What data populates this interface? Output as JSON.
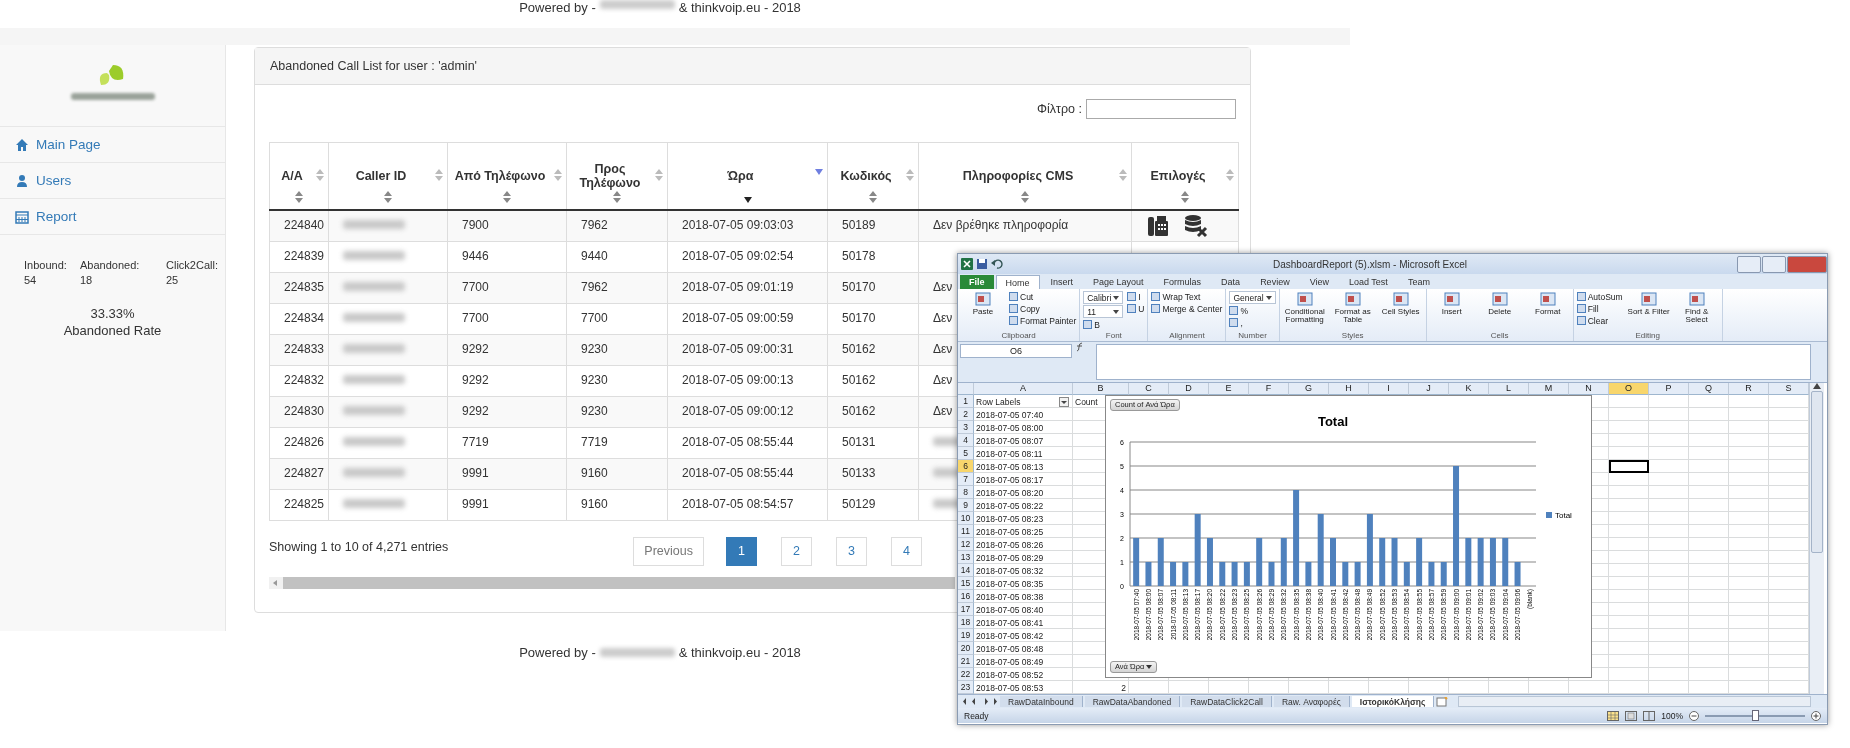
{
  "header": {
    "powered_prefix": "Powered by -",
    "powered_suffix": "& thinkvoip.eu - 2018"
  },
  "sidebar": {
    "items": [
      {
        "label": "Main Page"
      },
      {
        "label": "Users"
      },
      {
        "label": "Report"
      }
    ],
    "stats": [
      {
        "label": "Inbound:",
        "value": "54"
      },
      {
        "label": "Abandoned:",
        "value": "18"
      },
      {
        "label": "Click2Call:",
        "value": "25"
      }
    ],
    "rate": "33.33%",
    "rate_label": "Abandoned Rate"
  },
  "panel": {
    "title": "Abandoned Call List for user : 'admin'",
    "filter_label": "Φίλτρο :",
    "columns": [
      {
        "label": "A/A",
        "sorted": false
      },
      {
        "label": "Caller ID",
        "sorted": false
      },
      {
        "label": "Από Τηλέφωνο",
        "sorted": false
      },
      {
        "label": "Προς Τηλέφωνο",
        "sorted": false
      },
      {
        "label": "Ώρα",
        "sorted": true
      },
      {
        "label": "Κωδικός",
        "sorted": false
      },
      {
        "label": "Πληροφορίες CMS",
        "sorted": false
      },
      {
        "label": "Επιλογές",
        "sorted": false
      }
    ],
    "rows": [
      {
        "id": "224840",
        "from": "7900",
        "to": "7962",
        "time": "2018-07-05 09:03:03",
        "code": "50189",
        "cms": "Δεν βρέθηκε πληροφορία",
        "actions": true
      },
      {
        "id": "224839",
        "from": "9446",
        "to": "9440",
        "time": "2018-07-05 09:02:54",
        "code": "50178"
      },
      {
        "id": "224835",
        "from": "7700",
        "to": "7962",
        "time": "2018-07-05 09:01:19",
        "code": "50170",
        "cms": "Δεν"
      },
      {
        "id": "224834",
        "from": "7700",
        "to": "7700",
        "time": "2018-07-05 09:00:59",
        "code": "50170",
        "cms": "Δεν"
      },
      {
        "id": "224833",
        "from": "9292",
        "to": "9230",
        "time": "2018-07-05 09:00:31",
        "code": "50162",
        "cms": "Δεν"
      },
      {
        "id": "224832",
        "from": "9292",
        "to": "9230",
        "time": "2018-07-05 09:00:13",
        "code": "50162",
        "cms": "Δεν"
      },
      {
        "id": "224830",
        "from": "9292",
        "to": "9230",
        "time": "2018-07-05 09:00:12",
        "code": "50162",
        "cms": "Δεν"
      },
      {
        "id": "224826",
        "from": "7719",
        "to": "7719",
        "time": "2018-07-05 08:55:44",
        "code": "50131"
      },
      {
        "id": "224827",
        "from": "9991",
        "to": "9160",
        "time": "2018-07-05 08:55:44",
        "code": "50133"
      },
      {
        "id": "224825",
        "from": "9991",
        "to": "9160",
        "time": "2018-07-05 08:54:57",
        "code": "50129"
      }
    ],
    "info": "Showing 1 to 10 of 4,271 entries",
    "pagination": [
      {
        "label": "Previous",
        "kind": "nav",
        "selected": false
      },
      {
        "label": "1",
        "kind": "page",
        "selected": true
      },
      {
        "label": "2",
        "kind": "page",
        "selected": false
      },
      {
        "label": "3",
        "kind": "page",
        "selected": false
      },
      {
        "label": "4",
        "kind": "page",
        "selected": false
      }
    ]
  },
  "footer": {
    "powered_prefix": "Powered by -",
    "powered_suffix": "& thinkvoip.eu - 2018"
  },
  "excel": {
    "title": "DashboardReport (5).xlsm - Microsoft Excel",
    "tabs": [
      {
        "label": "File",
        "kind": "file",
        "selected": false
      },
      {
        "label": "Home",
        "kind": "tab",
        "selected": true
      },
      {
        "label": "Insert",
        "kind": "tab",
        "selected": false
      },
      {
        "label": "Page Layout",
        "kind": "tab",
        "selected": false
      },
      {
        "label": "Formulas",
        "kind": "tab",
        "selected": false
      },
      {
        "label": "Data",
        "kind": "tab",
        "selected": false
      },
      {
        "label": "Review",
        "kind": "tab",
        "selected": false
      },
      {
        "label": "View",
        "kind": "tab",
        "selected": false
      },
      {
        "label": "Load Test",
        "kind": "tab",
        "selected": false
      },
      {
        "label": "Team",
        "kind": "tab",
        "selected": false
      }
    ],
    "groups": [
      {
        "label": "Clipboard",
        "items": [
          {
            "label": "Paste",
            "kind": "large"
          },
          {
            "label": "Cut",
            "kind": "small"
          },
          {
            "label": "Copy",
            "kind": "small"
          },
          {
            "label": "Format Painter",
            "kind": "small"
          }
        ]
      },
      {
        "label": "Font",
        "items": [
          {
            "label": "Calibri",
            "kind": "field"
          },
          {
            "label": "11",
            "kind": "field"
          },
          {
            "label": "B",
            "kind": "small"
          },
          {
            "label": "I",
            "kind": "small"
          },
          {
            "label": "U",
            "kind": "small"
          }
        ]
      },
      {
        "label": "Alignment",
        "items": [
          {
            "label": "Wrap Text",
            "kind": "small"
          },
          {
            "label": "Merge & Center",
            "kind": "small"
          }
        ]
      },
      {
        "label": "Number",
        "items": [
          {
            "label": "General",
            "kind": "field"
          },
          {
            "label": "%",
            "kind": "small"
          },
          {
            "label": ",",
            "kind": "small"
          }
        ]
      },
      {
        "label": "Styles",
        "items": [
          {
            "label": "Conditional Formatting",
            "kind": "large"
          },
          {
            "label": "Format as Table",
            "kind": "large"
          },
          {
            "label": "Cell Styles",
            "kind": "large"
          }
        ]
      },
      {
        "label": "Cells",
        "items": [
          {
            "label": "Insert",
            "kind": "large"
          },
          {
            "label": "Delete",
            "kind": "large"
          },
          {
            "label": "Format",
            "kind": "large"
          }
        ]
      },
      {
        "label": "Editing",
        "items": [
          {
            "label": "AutoSum",
            "kind": "small"
          },
          {
            "label": "Fill",
            "kind": "small"
          },
          {
            "label": "Clear",
            "kind": "small"
          },
          {
            "label": "Sort & Filter",
            "kind": "large"
          },
          {
            "label": "Find & Select",
            "kind": "large"
          }
        ]
      }
    ],
    "name_box": "O6",
    "columns": [
      {
        "label": "A",
        "selected": false
      },
      {
        "label": "B",
        "selected": false
      },
      {
        "label": "C",
        "selected": false
      },
      {
        "label": "D",
        "selected": false
      },
      {
        "label": "E",
        "selected": false
      },
      {
        "label": "F",
        "selected": false
      },
      {
        "label": "G",
        "selected": false
      },
      {
        "label": "H",
        "selected": false
      },
      {
        "label": "I",
        "selected": false
      },
      {
        "label": "J",
        "selected": false
      },
      {
        "label": "K",
        "selected": false
      },
      {
        "label": "L",
        "selected": false
      },
      {
        "label": "M",
        "selected": false
      },
      {
        "label": "N",
        "selected": false
      },
      {
        "label": "O",
        "selected": true
      },
      {
        "label": "P",
        "selected": false
      },
      {
        "label": "Q",
        "selected": false
      },
      {
        "label": "R",
        "selected": false
      },
      {
        "label": "S",
        "selected": false
      }
    ],
    "rows": [
      {
        "num": "1",
        "a": "Row Labels",
        "b": "Count",
        "selected": false,
        "filter": true
      },
      {
        "num": "2",
        "a": "2018-07-05 07:40",
        "selected": false
      },
      {
        "num": "3",
        "a": "2018-07-05 08:00",
        "selected": false
      },
      {
        "num": "4",
        "a": "2018-07-05 08:07",
        "selected": false
      },
      {
        "num": "5",
        "a": "2018-07-05 08:11",
        "selected": false
      },
      {
        "num": "6",
        "a": "2018-07-05 08:13",
        "selected": true
      },
      {
        "num": "7",
        "a": "2018-07-05 08:17",
        "selected": false
      },
      {
        "num": "8",
        "a": "2018-07-05 08:20",
        "selected": false
      },
      {
        "num": "9",
        "a": "2018-07-05 08:22",
        "selected": false
      },
      {
        "num": "10",
        "a": "2018-07-05 08:23",
        "selected": false
      },
      {
        "num": "11",
        "a": "2018-07-05 08:25",
        "selected": false
      },
      {
        "num": "12",
        "a": "2018-07-05 08:26",
        "selected": false
      },
      {
        "num": "13",
        "a": "2018-07-05 08:29",
        "selected": false
      },
      {
        "num": "14",
        "a": "2018-07-05 08:32",
        "selected": false
      },
      {
        "num": "15",
        "a": "2018-07-05 08:35",
        "selected": false
      },
      {
        "num": "16",
        "a": "2018-07-05 08:38",
        "selected": false
      },
      {
        "num": "17",
        "a": "2018-07-05 08:40",
        "selected": false
      },
      {
        "num": "18",
        "a": "2018-07-05 08:41",
        "selected": false
      },
      {
        "num": "19",
        "a": "2018-07-05 08:42",
        "selected": false
      },
      {
        "num": "20",
        "a": "2018-07-05 08:48",
        "selected": false
      },
      {
        "num": "21",
        "a": "2018-07-05 08:49",
        "selected": false
      },
      {
        "num": "22",
        "a": "2018-07-05 08:52",
        "selected": false
      },
      {
        "num": "23",
        "a": "2018-07-05 08:53",
        "b": "2",
        "selected": false
      }
    ],
    "pivot_value_button": "Count of Ανά Ώρα",
    "pivot_axis_button": "Ανά Ώρα",
    "chart_data": {
      "type": "bar",
      "title": "Total",
      "grid": true,
      "categories": [
        "2018-07-05 07:40",
        "2018-07-05 08:00",
        "2018-07-05 08:07",
        "2018-07-05 08:11",
        "2018-07-05 08:13",
        "2018-07-05 08:17",
        "2018-07-05 08:20",
        "2018-07-05 08:22",
        "2018-07-05 08:23",
        "2018-07-05 08:25",
        "2018-07-05 08:26",
        "2018-07-05 08:29",
        "2018-07-05 08:32",
        "2018-07-05 08:35",
        "2018-07-05 08:38",
        "2018-07-05 08:40",
        "2018-07-05 08:41",
        "2018-07-05 08:42",
        "2018-07-05 08:48",
        "2018-07-05 08:49",
        "2018-07-05 08:52",
        "2018-07-05 08:53",
        "2018-07-05 08:54",
        "2018-07-05 08:55",
        "2018-07-05 08:57",
        "2018-07-05 08:59",
        "2018-07-05 09:00",
        "2018-07-05 09:01",
        "2018-07-05 09:02",
        "2018-07-05 09:03",
        "2018-07-05 09:04",
        "2018-07-05 09:06",
        "(blank)"
      ],
      "series": [
        {
          "name": "Total",
          "color": "#4f81bd",
          "values": [
            2,
            1,
            2,
            1,
            1,
            3,
            2,
            1,
            1,
            1,
            2,
            1,
            2,
            4,
            1,
            3,
            2,
            1,
            1,
            3,
            2,
            2,
            1,
            2,
            1,
            1,
            5,
            2,
            2,
            2,
            2,
            1,
            null
          ]
        }
      ],
      "ylim": [
        0,
        6
      ],
      "yticks": [
        0,
        1,
        2,
        3,
        4,
        5,
        6
      ]
    },
    "sheets": [
      {
        "label": "RawDataInbound",
        "selected": false
      },
      {
        "label": "RawDataAbandoned",
        "selected": false
      },
      {
        "label": "RawDataClick2Call",
        "selected": false
      },
      {
        "label": "Raw. Αναφορές",
        "selected": false
      },
      {
        "label": "ΙστορικόΚλήσης",
        "selected": true
      }
    ],
    "status": "Ready",
    "zoom": {
      "reading": "100%",
      "level": 0.5
    }
  }
}
